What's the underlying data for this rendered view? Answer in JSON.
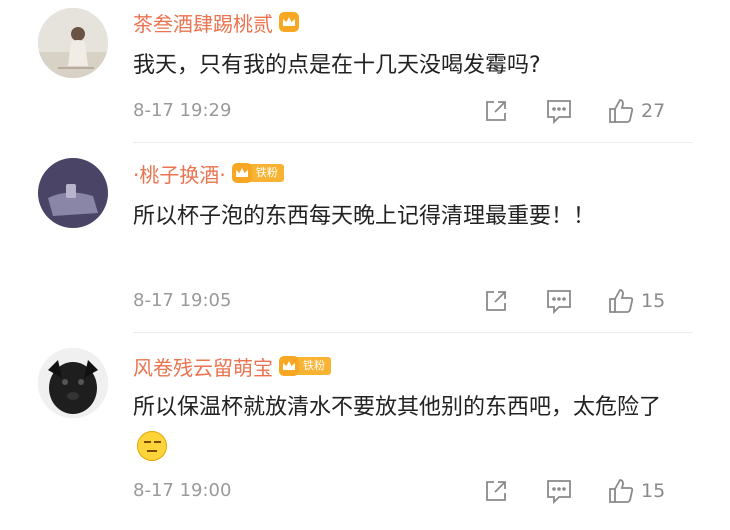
{
  "comments": [
    {
      "username": "茶叁酒肆踢桃贰",
      "text": "我天，只有我的点是在十几天没喝发霉吗?",
      "time": "8-17 19:29",
      "likes": "27",
      "badge_pill": ""
    },
    {
      "username": "·桃子换酒·",
      "text": "所以杯子泡的东西每天晚上记得清理最重要！！",
      "time": "8-17 19:05",
      "likes": "15",
      "badge_pill": "铁粉"
    },
    {
      "username": "风卷残云留萌宝",
      "text": "所以保温杯就放清水不要放其他别的东西吧，太危险了",
      "time": "8-17 19:00",
      "likes": "15",
      "badge_pill": "铁粉"
    }
  ],
  "icons": {
    "share": "share-icon",
    "reply": "comment-icon",
    "like": "thumbs-up-icon",
    "crown": "crown-icon",
    "emoji": "emoji-icon"
  },
  "colors": {
    "username": "#eb7350",
    "badge": "#f9b333",
    "text": "#222222",
    "meta": "#9a9a9a"
  }
}
